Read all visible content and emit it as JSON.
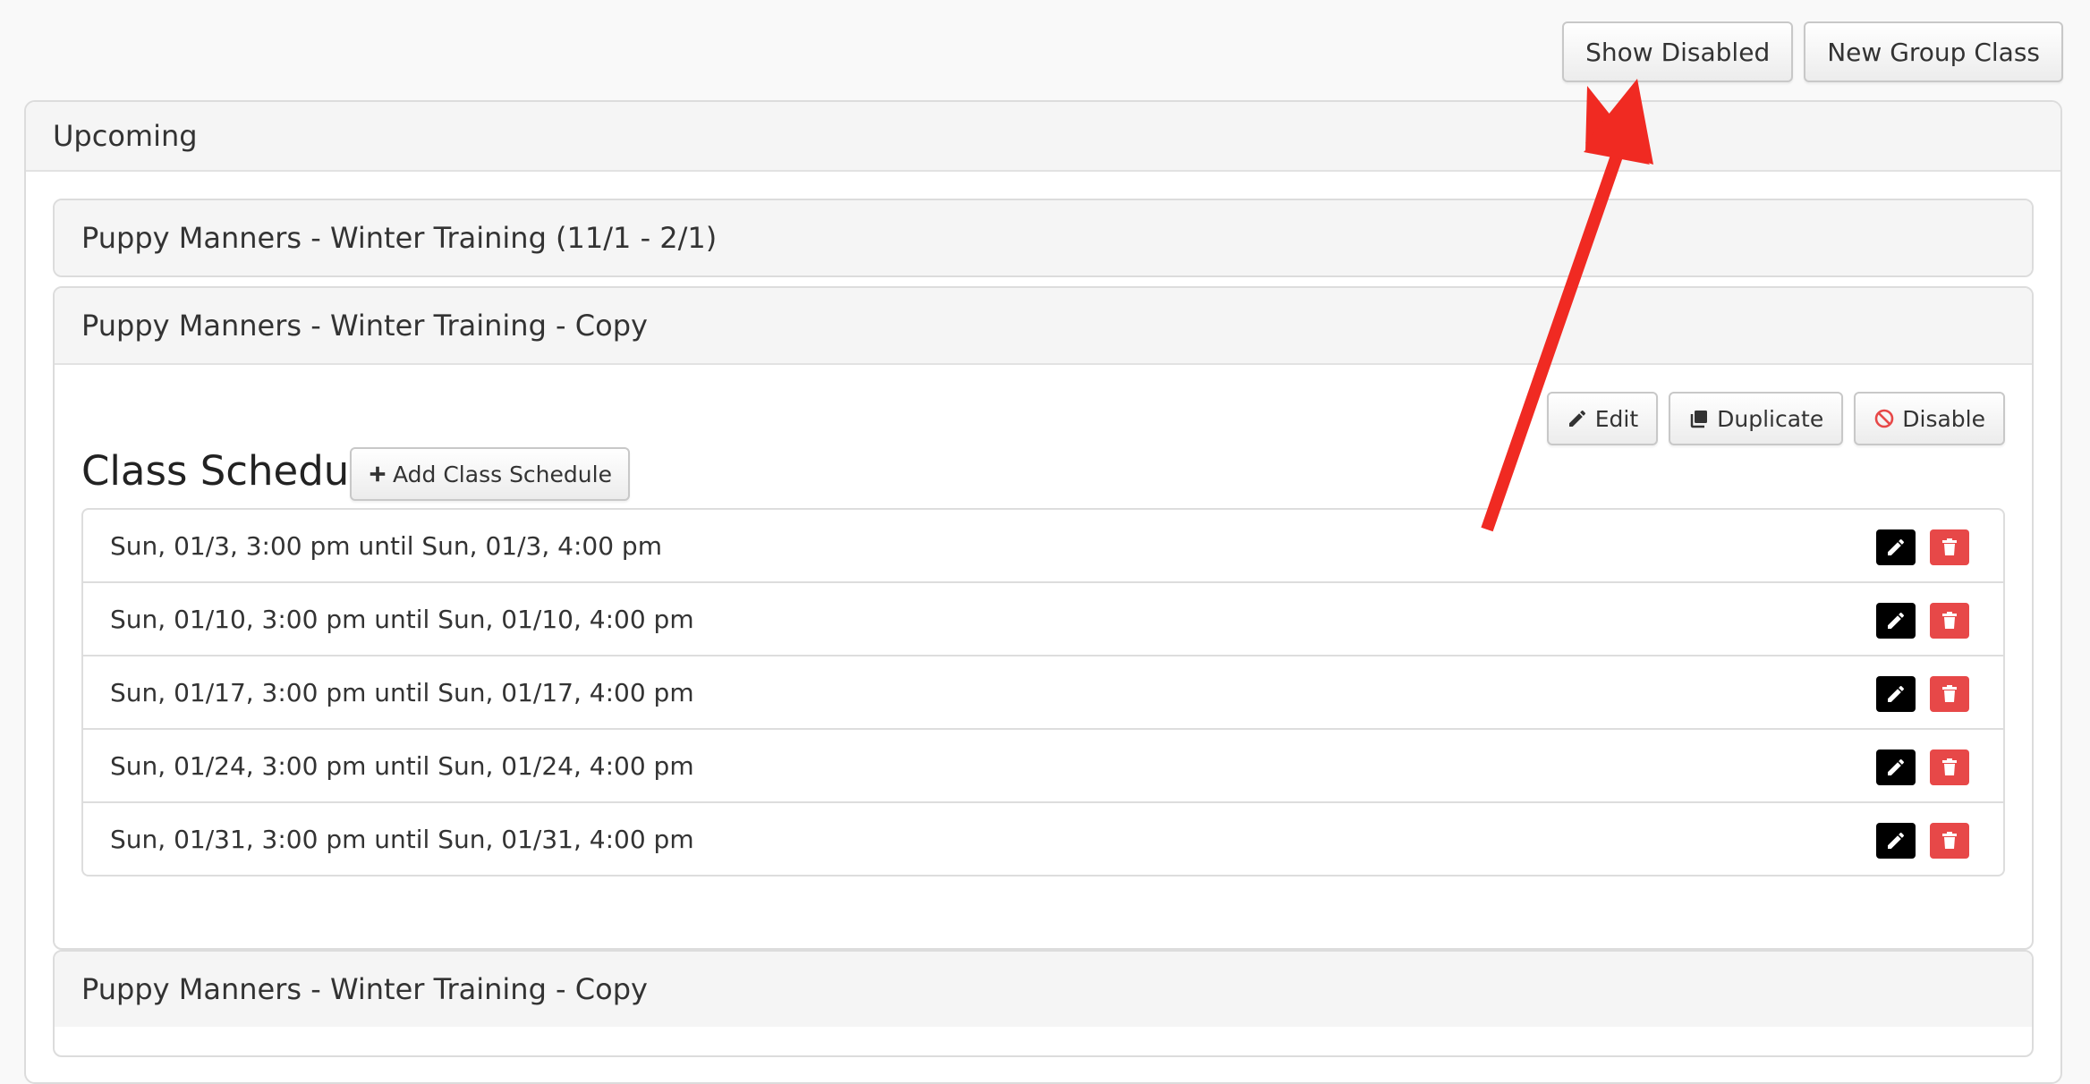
{
  "toolbar": {
    "show_disabled_label": "Show Disabled",
    "new_group_class_label": "New Group Class"
  },
  "section": {
    "title": "Upcoming"
  },
  "classes": [
    {
      "title": "Puppy Manners - Winter Training (11/1 - 2/1)"
    },
    {
      "title": "Puppy Manners - Winter Training - Copy",
      "actions": {
        "edit": "Edit",
        "duplicate": "Duplicate",
        "disable": "Disable"
      },
      "schedule": {
        "heading": "Class Schedule",
        "add_label": "Add Class Schedule",
        "rows": [
          "Sun, 01/3, 3:00 pm until Sun, 01/3, 4:00 pm",
          "Sun, 01/10, 3:00 pm until Sun, 01/10, 4:00 pm",
          "Sun, 01/17, 3:00 pm until Sun, 01/17, 4:00 pm",
          "Sun, 01/24, 3:00 pm until Sun, 01/24, 4:00 pm",
          "Sun, 01/31, 3:00 pm until Sun, 01/31, 4:00 pm"
        ]
      }
    },
    {
      "title": "Puppy Manners - Winter Training - Copy"
    }
  ],
  "icons": {
    "edit": "pencil-icon",
    "duplicate": "copy-icon",
    "disable": "ban-icon",
    "add": "plus-icon",
    "delete": "trash-icon"
  },
  "colors": {
    "edit_button_bg": "#000000",
    "delete_button_bg": "#e74848",
    "disable_icon": "#e74848",
    "annotation_arrow": "#f02a22"
  }
}
